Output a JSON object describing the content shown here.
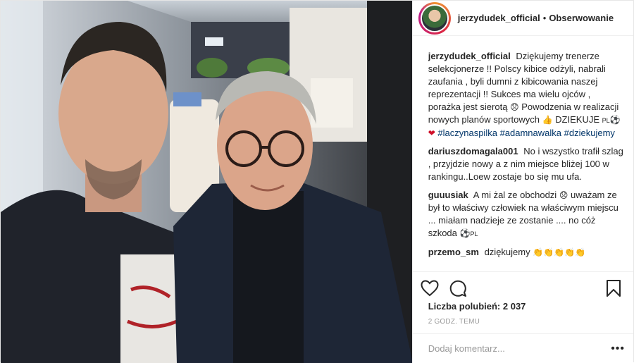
{
  "header": {
    "username": "jerzydudek_official",
    "separator": "•",
    "follow_label": "Obserwowanie"
  },
  "caption": {
    "username": "jerzydudek_official",
    "text1": "Dziękujemy trenerze selekcjonerze !! Polscy kibice odżyli, nabrali zaufania , byli dumni z kibicowania naszej reprezentacji !! Sukces ma wielu ojców , porażka jest sierotą",
    "text2": "Powodzenia w realizacji nowych planów sportowych",
    "text3": "DZIEKUJE",
    "flag": "PL",
    "hashtag1": "#laczynaspilka",
    "hashtag2": "#adamnawalka",
    "hashtag3": "#dziekujemy"
  },
  "comments": [
    {
      "username": "dariuszdomagala001",
      "text": "No i wszystko trafił szlag , przyjdzie nowy a z nim miejsce bliżej 100 w rankingu..Loew zostaje bo się mu ufa."
    },
    {
      "username": "guuusiak",
      "text1": "A mi żal ze obchodzi",
      "text2": "uważam ze był to właściwy człowiek na właściwym miejscu ... miałam nadzieje ze zostanie .... no cóż szkoda",
      "flag": "PL"
    },
    {
      "username": "przemo_sm",
      "text": "dziękujemy"
    }
  ],
  "actions": {
    "like_icon": "heart-outline-icon",
    "comment_icon": "speech-bubble-icon",
    "save_icon": "bookmark-icon"
  },
  "likes_text": "Liczba polubień: 2 037",
  "timestamp": "2 GODZ. TEMU",
  "add_comment": {
    "placeholder": "Dodaj komentarz...",
    "more_label": "•••"
  },
  "colors": {
    "link": "#003569",
    "border": "#efefef",
    "muted": "#999999"
  }
}
